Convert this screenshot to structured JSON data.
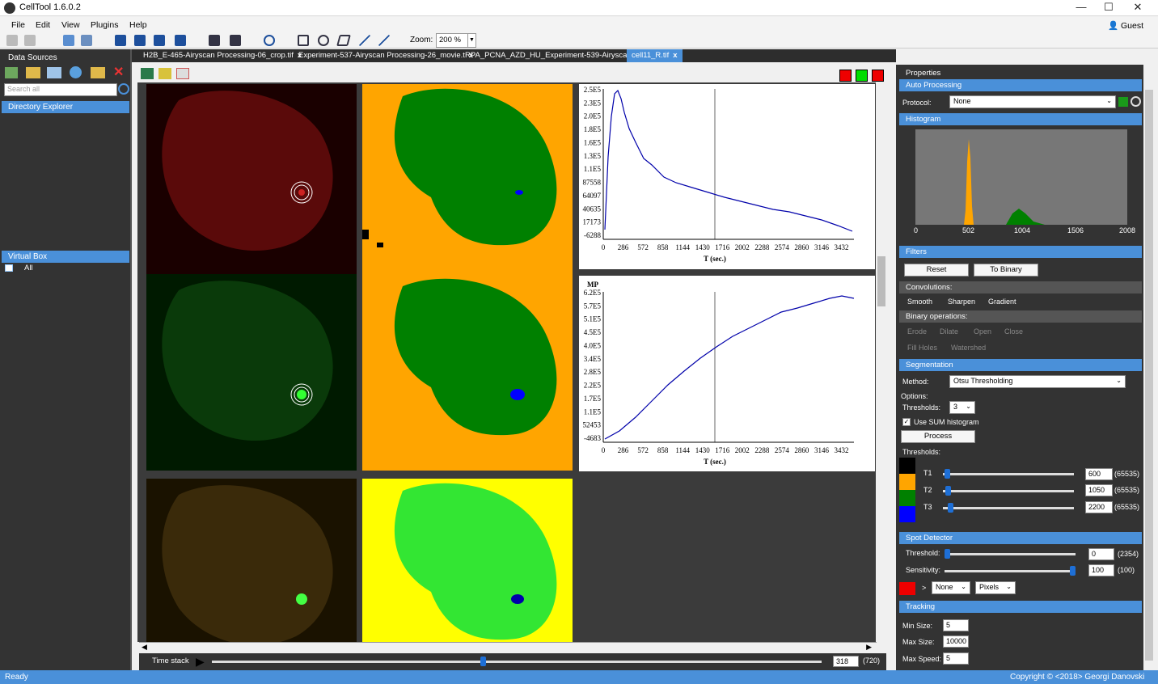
{
  "window": {
    "title": "CellTool 1.6.0.2",
    "minimize_label": "—",
    "maximize_label": "☐",
    "close_label": "✕"
  },
  "menu": {
    "items": [
      "File",
      "Edit",
      "View",
      "Plugins",
      "Help"
    ],
    "user": "Guest"
  },
  "toolbar": {
    "zoom_label": "Zoom:",
    "zoom_value": "200 %"
  },
  "left_panel": {
    "data_sources": "Data Sources",
    "search_placeholder": "Search all",
    "directory_explorer": "Directory Explorer",
    "virtual_box": "Virtual Box",
    "all_item": "All"
  },
  "tabs": [
    {
      "label": "H2B_E-465-Airyscan Processing-06_crop.tif",
      "close": "x"
    },
    {
      "label": "Experiment-537-Airyscan Processing-26_movie.t",
      "close": "x"
    },
    {
      "label": "RPA_PCNA_AZD_HU_Experiment-539-Airyscar",
      "close": "x"
    },
    {
      "label": "cell11_R.tif",
      "close": "x"
    }
  ],
  "plots": {
    "plot1": {
      "yticks": [
        "2.5E5",
        "2.3E5",
        "2.0E5",
        "1.8E5",
        "1.6E5",
        "1.3E5",
        "1.1E5",
        "87558",
        "64097",
        "40635",
        "17173",
        "-6288"
      ],
      "xticks": [
        "0",
        "286",
        "572",
        "858",
        "1144",
        "1430",
        "1716",
        "2002",
        "2288",
        "2574",
        "2860",
        "3146",
        "3432"
      ],
      "xlabel": "T (sec.)"
    },
    "plot2": {
      "ylabel": "MP",
      "yticks": [
        "6.2E5",
        "5.7E5",
        "5.1E5",
        "4.5E5",
        "4.0E5",
        "3.4E5",
        "2.8E5",
        "2.2E5",
        "1.7E5",
        "1.1E5",
        "52453",
        "-4683"
      ],
      "xticks": [
        "0",
        "286",
        "572",
        "858",
        "1144",
        "1430",
        "1716",
        "2002",
        "2288",
        "2574",
        "2860",
        "3146",
        "3432"
      ],
      "xlabel": "T (sec.)"
    }
  },
  "timestack": {
    "label": "Time stack",
    "value": "318",
    "max": "(720)",
    "position": 0.44
  },
  "properties": {
    "title": "Properties",
    "auto_processing": "Auto Processing",
    "protocol_label": "Protocol:",
    "protocol_value": "None",
    "histogram": "Histogram",
    "hist_ticks": [
      "0",
      "502",
      "1004",
      "1506",
      "2008"
    ],
    "filters": "Filters",
    "reset": "Reset",
    "to_binary": "To Binary",
    "convolutions": "Convolutions:",
    "conv_items": [
      "Smooth",
      "Sharpen",
      "Gradient"
    ],
    "binary_ops": "Binary operations:",
    "binary_items": [
      "Erode",
      "Dilate",
      "Open",
      "Close"
    ],
    "binary_items2": [
      "Fill Holes",
      "Watershed"
    ],
    "segmentation": "Segmentation",
    "method_label": "Method:",
    "method_value": "Otsu Thresholding",
    "options": "Options:",
    "thresholds_label": "Thresholds:",
    "thresholds_value": "3",
    "use_sum": "Use SUM histogram",
    "process": "Process",
    "thresholds_group": "Thresholds:",
    "thresholds": [
      {
        "name": "T1",
        "value": "600",
        "max": "(65535)",
        "color": "#000000",
        "position": 0.01
      },
      {
        "name": "T2",
        "value": "1050",
        "max": "(65535)",
        "color": "#ffa500",
        "position": 0.016
      },
      {
        "name": "T3",
        "value": "2200",
        "max": "(65535)",
        "color": "#008000",
        "position": 0.034
      }
    ],
    "last_color": "#0000ff",
    "spot_detector": "Spot Detector",
    "threshold_label": "Threshold:",
    "threshold_value": "0",
    "threshold_max": "(2354)",
    "sensitivity_label": "Sensitivity:",
    "sensitivity_value": "100",
    "sensitivity_max": "(100)",
    "spot_arrow": ">",
    "spot_select1": "None",
    "spot_select2": "Pixels",
    "tracking": "Tracking",
    "min_size_label": "Min Size:",
    "min_size": "5",
    "max_size_label": "Max Size:",
    "max_size": "10000",
    "max_speed_label": "Max Speed:",
    "max_speed": "5"
  },
  "status": {
    "left": "Ready",
    "right": "Copyright © <2018> Georgi Danovski"
  },
  "colors": {
    "accent": "#4a90d9",
    "panel": "#333333"
  }
}
